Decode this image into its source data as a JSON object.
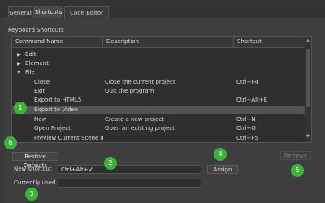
{
  "tabs": [
    {
      "label": "General"
    },
    {
      "label": "Shortcuts"
    },
    {
      "label": "Code Editor"
    }
  ],
  "section_title": "Keyboard Shortcuts",
  "table": {
    "columns": [
      "Command Name",
      "Description",
      "Shortcut"
    ],
    "rows": [
      {
        "name": "Edit",
        "description": "",
        "shortcut": "",
        "group": "collapsed"
      },
      {
        "name": "Element",
        "description": "",
        "shortcut": "",
        "group": "collapsed"
      },
      {
        "name": "File",
        "description": "",
        "shortcut": "",
        "group": "expanded"
      },
      {
        "name": "Close",
        "description": "Close the current project",
        "shortcut": "Ctrl+F4"
      },
      {
        "name": "Exit",
        "description": "Quit the program",
        "shortcut": ""
      },
      {
        "name": "Export to HTML5",
        "description": "",
        "shortcut": "Ctrl+Alt+E"
      },
      {
        "name": "Export to Video",
        "description": "",
        "shortcut": "",
        "selected": true
      },
      {
        "name": "New",
        "description": "Create a new project",
        "shortcut": "Ctrl+N"
      },
      {
        "name": "Open Project",
        "description": "Open an existing project",
        "shortcut": "Ctrl+O"
      },
      {
        "name": "Preview Current Scene in B...",
        "description": "",
        "shortcut": "Ctrl+F5"
      }
    ]
  },
  "buttons": {
    "restore_defaults": "Restore Defaults",
    "assign": "Assign",
    "remove": "Remove"
  },
  "new_shortcut": {
    "label": "New shortcut",
    "value": "Ctrl+Alt+V"
  },
  "currently_used_by": {
    "label": "Currently used by",
    "value": ""
  },
  "badges": [
    "1",
    "2",
    "3",
    "4",
    "5",
    "6"
  ],
  "colors": {
    "badge": "#3bb33b",
    "selection": "#525252"
  }
}
